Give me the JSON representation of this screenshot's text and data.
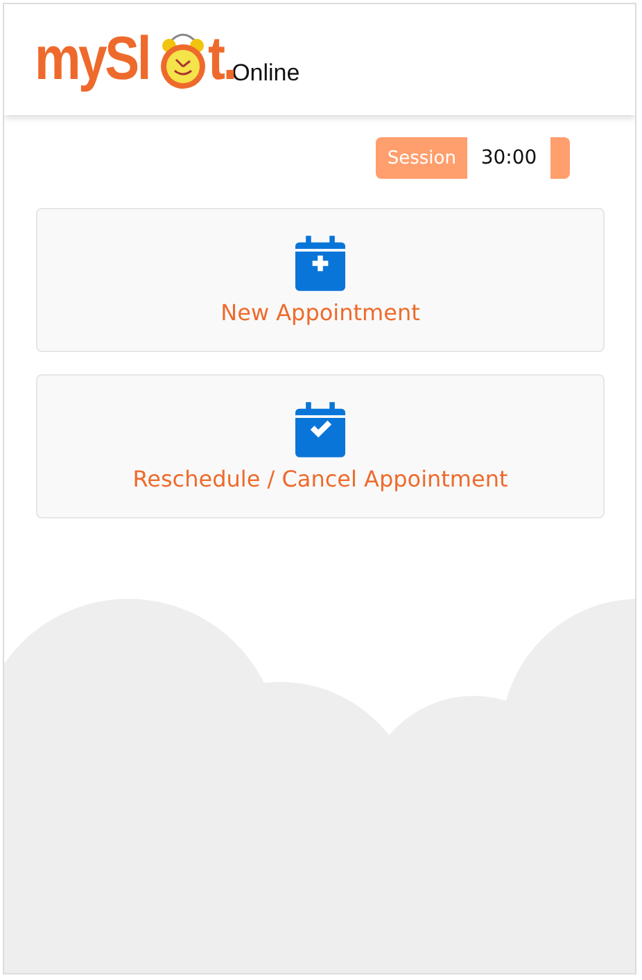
{
  "logo": {
    "lead": "mySl",
    "tail": "t.",
    "suffix": "Online"
  },
  "session": {
    "label": "Session",
    "time": "30:00"
  },
  "actions": [
    {
      "kind": "add",
      "label": "New Appointment"
    },
    {
      "kind": "check",
      "label": "Reschedule / Cancel Appointment"
    }
  ]
}
